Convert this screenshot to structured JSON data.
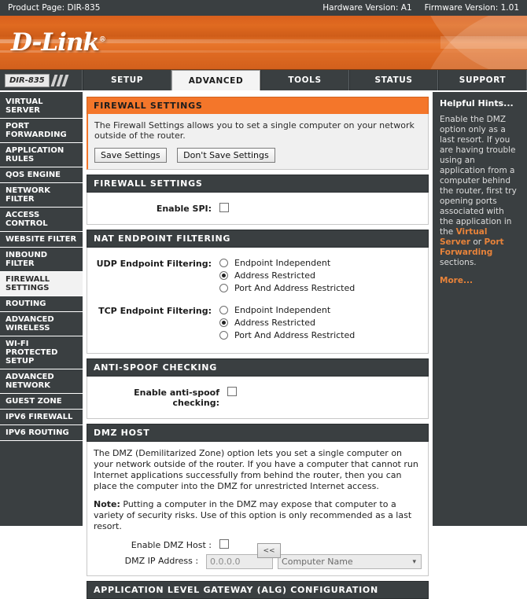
{
  "topbar": {
    "product_page": "Product Page: DIR-835",
    "hardware_version": "Hardware Version: A1",
    "firmware_version": "Firmware Version: 1.01"
  },
  "brand": {
    "name": "D-Link",
    "registered": "®"
  },
  "nav": {
    "model": "DIR-835",
    "tabs": [
      {
        "label": "SETUP",
        "active": false
      },
      {
        "label": "ADVANCED",
        "active": true
      },
      {
        "label": "TOOLS",
        "active": false
      },
      {
        "label": "STATUS",
        "active": false
      },
      {
        "label": "SUPPORT",
        "active": false
      }
    ]
  },
  "sidebar": {
    "items": [
      {
        "label": "VIRTUAL SERVER",
        "active": false
      },
      {
        "label": "PORT FORWARDING",
        "active": false
      },
      {
        "label": "APPLICATION RULES",
        "active": false
      },
      {
        "label": "QOS ENGINE",
        "active": false
      },
      {
        "label": "NETWORK FILTER",
        "active": false
      },
      {
        "label": "ACCESS CONTROL",
        "active": false
      },
      {
        "label": "WEBSITE FILTER",
        "active": false
      },
      {
        "label": "INBOUND FILTER",
        "active": false
      },
      {
        "label": "FIREWALL SETTINGS",
        "active": true
      },
      {
        "label": "ROUTING",
        "active": false
      },
      {
        "label": "ADVANCED WIRELESS",
        "active": false
      },
      {
        "label": "WI-FI PROTECTED SETUP",
        "active": false
      },
      {
        "label": "ADVANCED NETWORK",
        "active": false
      },
      {
        "label": "GUEST ZONE",
        "active": false
      },
      {
        "label": "IPV6 FIREWALL",
        "active": false
      },
      {
        "label": "IPV6 ROUTING",
        "active": false
      }
    ]
  },
  "main": {
    "intro": {
      "header": "FIREWALL SETTINGS",
      "description": "The Firewall Settings allows you to set a single computer on your network outside of the router.",
      "save_label": "Save Settings",
      "dont_save_label": "Don't Save Settings"
    },
    "firewall": {
      "header": "FIREWALL SETTINGS",
      "enable_spi_label": "Enable SPI:",
      "enable_spi_checked": false
    },
    "nat": {
      "header": "NAT ENDPOINT FILTERING",
      "udp_label": "UDP Endpoint Filtering:",
      "tcp_label": "TCP Endpoint Filtering:",
      "options": [
        "Endpoint Independent",
        "Address Restricted",
        "Port And Address Restricted"
      ],
      "udp_selected": "Address Restricted",
      "tcp_selected": "Address Restricted"
    },
    "antispoof": {
      "header": "ANTI-SPOOF CHECKING",
      "label": "Enable anti-spoof checking:",
      "checked": false
    },
    "dmz": {
      "header": "DMZ HOST",
      "paragraph": "The DMZ (Demilitarized Zone) option lets you set a single computer on your network outside of the router. If you have a computer that cannot run Internet applications successfully from behind the router, then you can place the computer into the DMZ for unrestricted Internet access.",
      "note_label": "Note:",
      "note_text": "Putting a computer in the DMZ may expose that computer to a variety of security risks. Use of this option is only recommended as a last resort.",
      "enable_label": "Enable DMZ Host :",
      "enable_checked": false,
      "ip_label": "DMZ IP Address :",
      "ip_value": "0.0.0.0",
      "computer_select_value": "Computer Name",
      "copy_button_label": "<<"
    },
    "alg": {
      "header": "APPLICATION LEVEL GATEWAY (ALG) CONFIGURATION"
    }
  },
  "hints": {
    "title": "Helpful Hints...",
    "text_before": "Enable the DMZ option only as a last resort. If you are having trouble using an application from a computer behind the router, first try opening ports associated with the application in the ",
    "link_one": "Virtual Server",
    "text_middle": " or ",
    "link_two": "Port Forwarding",
    "text_after": " sections.",
    "more": "More..."
  }
}
